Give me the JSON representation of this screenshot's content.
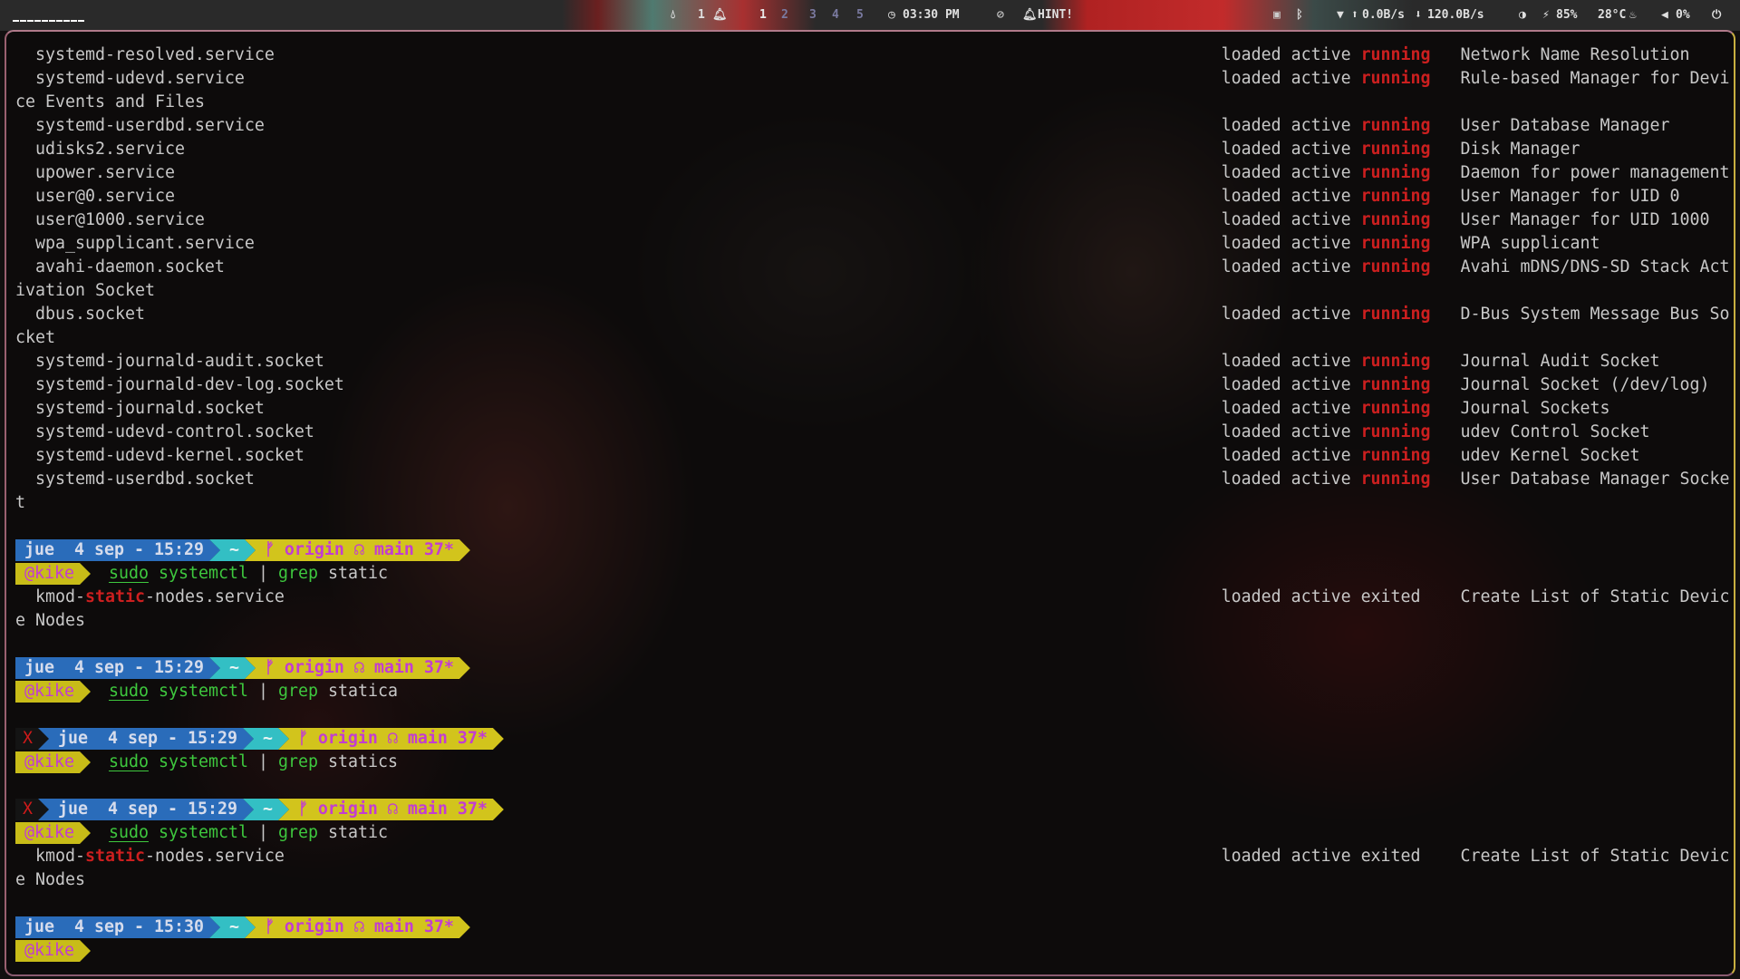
{
  "topbar": {
    "notifications_count": "1",
    "workspaces": [
      "1",
      "2",
      "3",
      "4",
      "5"
    ],
    "active_workspace": "1",
    "clock": "03:30 PM",
    "hint": "HINT!",
    "net_up": "0.0B/s",
    "net_down": "120.0B/s",
    "battery": "85%",
    "temperature": "28°C",
    "volume": "0%",
    "icons": [
      "droplet-icon",
      "bell-icon",
      "clock-icon",
      "eye-slash-icon",
      "bell-icon",
      "sd-card-icon",
      "bluetooth-off-icon",
      "wifi-icon",
      "arrow-up-circle-icon",
      "arrow-down-circle-icon",
      "contrast-icon",
      "bolt-icon",
      "flame-icon",
      "volume-icon",
      "power-icon"
    ]
  },
  "colors": {
    "running": "#cc1f1f",
    "command": "#3ec83e",
    "prompt_date_bg": "#2a6cba",
    "prompt_dir_bg": "#33bfc4",
    "prompt_git_bg": "#d2c41c",
    "prompt_git_fg": "#c23cd2"
  },
  "terminal": {
    "lines": [
      {
        "t": "unit",
        "name": "systemd-resolved.service",
        "load": "loaded",
        "active": "active",
        "sub": "running",
        "desc": "Network Name Resolution"
      },
      {
        "t": "unit",
        "name": "systemd-udevd.service",
        "load": "loaded",
        "active": "active",
        "sub": "running",
        "desc": "Rule-based Manager for Devi"
      },
      {
        "t": "wrap",
        "text": "ce Events and Files"
      },
      {
        "t": "unit",
        "name": "systemd-userdbd.service",
        "load": "loaded",
        "active": "active",
        "sub": "running",
        "desc": "User Database Manager"
      },
      {
        "t": "unit",
        "name": "udisks2.service",
        "load": "loaded",
        "active": "active",
        "sub": "running",
        "desc": "Disk Manager"
      },
      {
        "t": "unit",
        "name": "upower.service",
        "load": "loaded",
        "active": "active",
        "sub": "running",
        "desc": "Daemon for power management"
      },
      {
        "t": "unit",
        "name": "user@0.service",
        "load": "loaded",
        "active": "active",
        "sub": "running",
        "desc": "User Manager for UID 0"
      },
      {
        "t": "unit",
        "name": "user@1000.service",
        "load": "loaded",
        "active": "active",
        "sub": "running",
        "desc": "User Manager for UID 1000"
      },
      {
        "t": "unit",
        "name": "wpa_supplicant.service",
        "load": "loaded",
        "active": "active",
        "sub": "running",
        "desc": "WPA supplicant"
      },
      {
        "t": "unit",
        "name": "avahi-daemon.socket",
        "load": "loaded",
        "active": "active",
        "sub": "running",
        "desc": "Avahi mDNS/DNS-SD Stack Act"
      },
      {
        "t": "wrap",
        "text": "ivation Socket"
      },
      {
        "t": "unit",
        "name": "dbus.socket",
        "load": "loaded",
        "active": "active",
        "sub": "running",
        "desc": "D-Bus System Message Bus So"
      },
      {
        "t": "wrap",
        "text": "cket"
      },
      {
        "t": "unit",
        "name": "systemd-journald-audit.socket",
        "load": "loaded",
        "active": "active",
        "sub": "running",
        "desc": "Journal Audit Socket"
      },
      {
        "t": "unit",
        "name": "systemd-journald-dev-log.socket",
        "load": "loaded",
        "active": "active",
        "sub": "running",
        "desc": "Journal Socket (/dev/log)"
      },
      {
        "t": "unit",
        "name": "systemd-journald.socket",
        "load": "loaded",
        "active": "active",
        "sub": "running",
        "desc": "Journal Sockets"
      },
      {
        "t": "unit",
        "name": "systemd-udevd-control.socket",
        "load": "loaded",
        "active": "active",
        "sub": "running",
        "desc": "udev Control Socket"
      },
      {
        "t": "unit",
        "name": "systemd-udevd-kernel.socket",
        "load": "loaded",
        "active": "active",
        "sub": "running",
        "desc": "udev Kernel Socket"
      },
      {
        "t": "unit",
        "name": "systemd-userdbd.socket",
        "load": "loaded",
        "active": "active",
        "sub": "running",
        "desc": "User Database Manager Socke"
      },
      {
        "t": "wrap",
        "text": "t"
      },
      {
        "t": "blank"
      },
      {
        "t": "prompt",
        "error": "",
        "date": "jue  4 sep - 15:29",
        "dir": "~",
        "git": "ᚠ origin ☊ main 37*"
      },
      {
        "t": "cmd",
        "user": "@kike",
        "sudo": "sudo",
        "prog": "systemctl",
        "pipe": "|",
        "grep": "grep",
        "arg": "static"
      },
      {
        "t": "unit",
        "pre": "kmod-",
        "hl": "static",
        "post": "-nodes.service",
        "load": "loaded",
        "active": "active",
        "sub": "exited",
        "desc": "Create List of Static Devic"
      },
      {
        "t": "wrap",
        "text": "e Nodes"
      },
      {
        "t": "blank"
      },
      {
        "t": "prompt",
        "error": "",
        "date": "jue  4 sep - 15:29",
        "dir": "~",
        "git": "ᚠ origin ☊ main 37*"
      },
      {
        "t": "cmd",
        "user": "@kike",
        "sudo": "sudo",
        "prog": "systemctl",
        "pipe": "|",
        "grep": "grep",
        "arg": "statica"
      },
      {
        "t": "blank"
      },
      {
        "t": "prompt",
        "error": "X",
        "date": "jue  4 sep - 15:29",
        "dir": "~",
        "git": "ᚠ origin ☊ main 37*"
      },
      {
        "t": "cmd",
        "user": "@kike",
        "sudo": "sudo",
        "prog": "systemctl",
        "pipe": "|",
        "grep": "grep",
        "arg": "statics"
      },
      {
        "t": "blank"
      },
      {
        "t": "prompt",
        "error": "X",
        "date": "jue  4 sep - 15:29",
        "dir": "~",
        "git": "ᚠ origin ☊ main 37*"
      },
      {
        "t": "cmd",
        "user": "@kike",
        "sudo": "sudo",
        "prog": "systemctl",
        "pipe": "|",
        "grep": "grep",
        "arg": "static"
      },
      {
        "t": "unit",
        "pre": "kmod-",
        "hl": "static",
        "post": "-nodes.service",
        "load": "loaded",
        "active": "active",
        "sub": "exited",
        "desc": "Create List of Static Devic"
      },
      {
        "t": "wrap",
        "text": "e Nodes"
      },
      {
        "t": "blank"
      },
      {
        "t": "prompt",
        "error": "",
        "date": "jue  4 sep - 15:30",
        "dir": "~",
        "git": "ᚠ origin ☊ main 37*"
      },
      {
        "t": "cmd",
        "user": "@kike"
      }
    ]
  }
}
